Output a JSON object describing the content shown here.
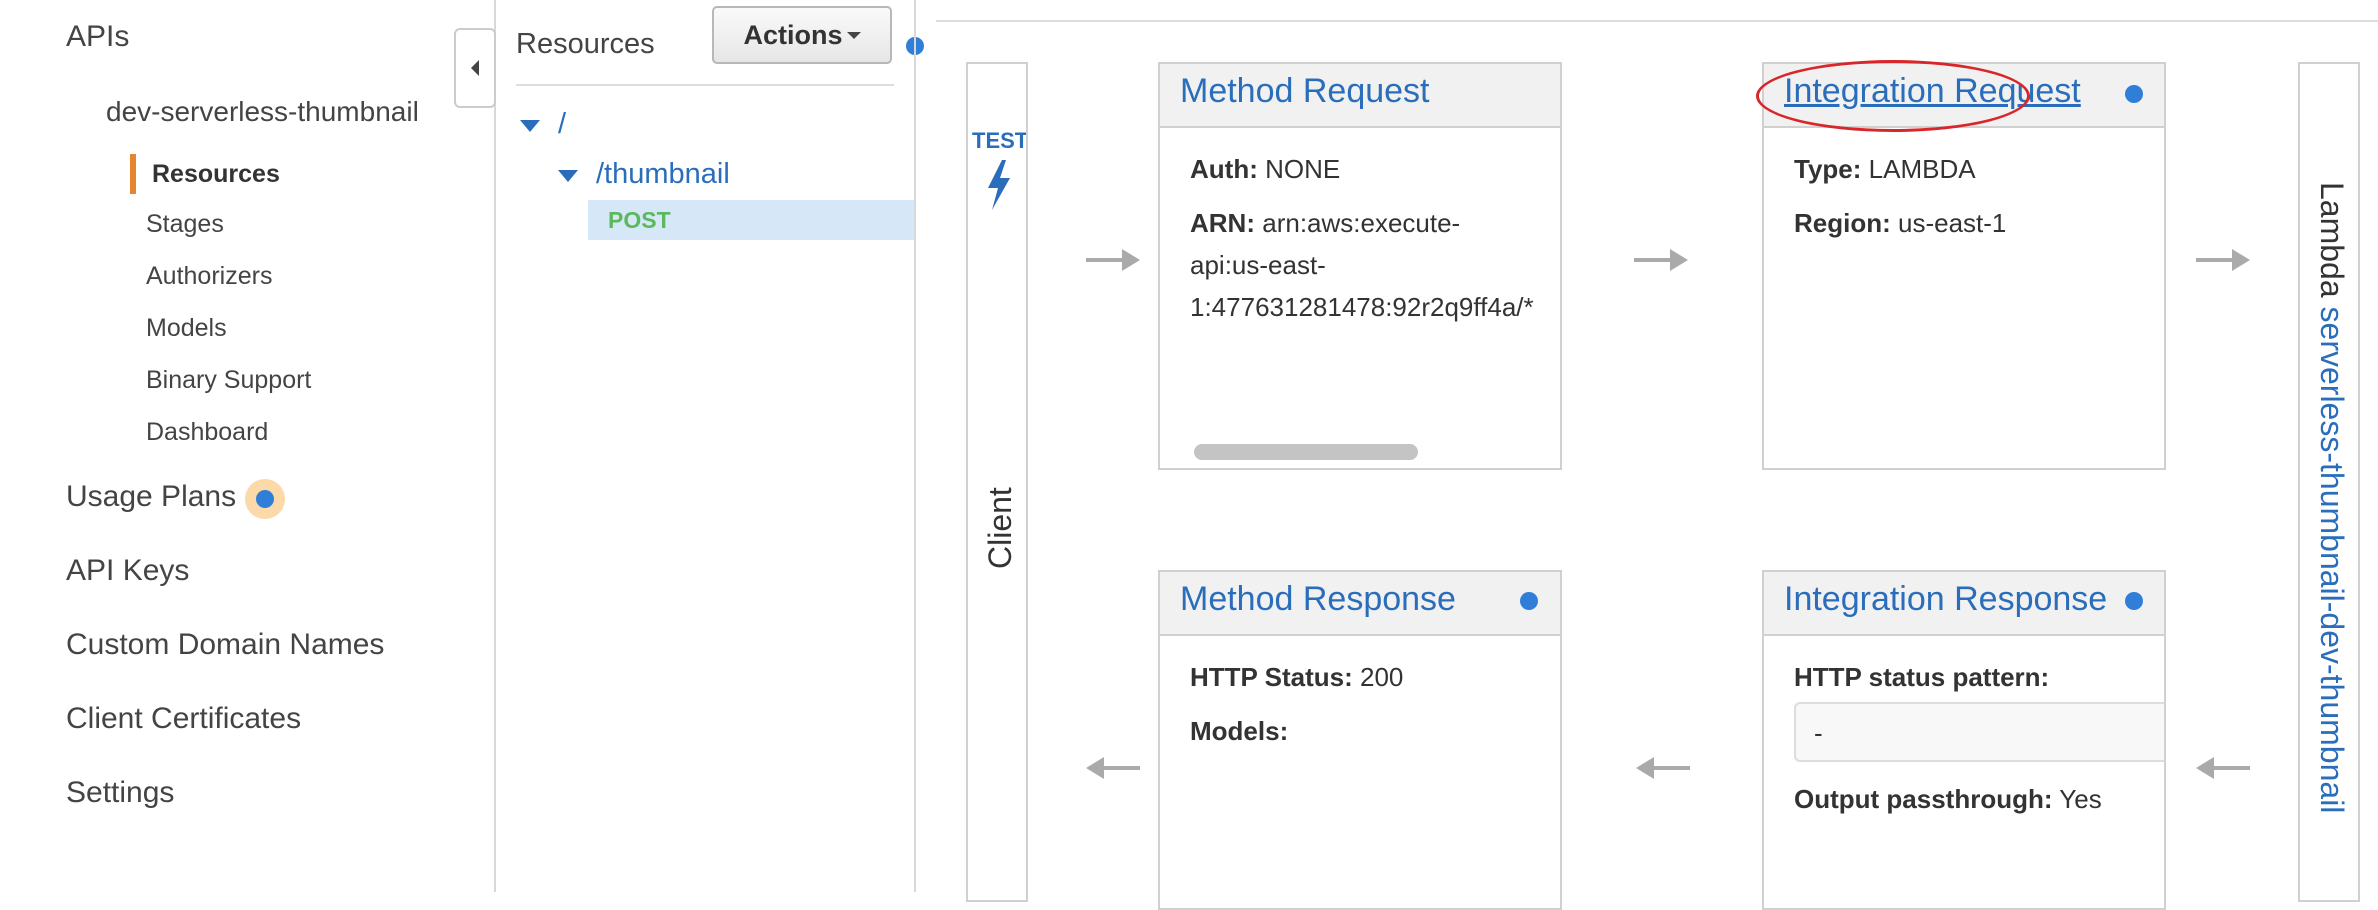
{
  "nav": {
    "apis": "APIs",
    "api_name": "dev-serverless-thumbnail",
    "sub_items": [
      "Resources",
      "Stages",
      "Authorizers",
      "Models",
      "Binary Support",
      "Dashboard"
    ],
    "items": [
      "Usage Plans",
      "API Keys",
      "Custom Domain Names",
      "Client Certificates",
      "Settings"
    ]
  },
  "resources": {
    "title": "Resources",
    "actions_label": "Actions",
    "root": "/",
    "child": "/thumbnail",
    "method": "POST"
  },
  "flow": {
    "client_label": "Client",
    "test_label": "TEST",
    "method_request": {
      "title": "Method Request",
      "auth_key": "Auth:",
      "auth_val": "NONE",
      "arn_key": "ARN:",
      "arn_line1": "arn:aws:execute-",
      "arn_line2": "api:us-east-",
      "arn_line3": "1:477631281478:92r2q9ff4a/*"
    },
    "integration_request": {
      "title": "Integration Request",
      "type_key": "Type:",
      "type_val": "LAMBDA",
      "region_key": "Region:",
      "region_val": "us-east-1"
    },
    "method_response": {
      "title": "Method Response",
      "status_key": "HTTP Status:",
      "status_val": "200",
      "models_key": "Models:"
    },
    "integration_response": {
      "title": "Integration Response",
      "pattern_key": "HTTP status pattern:",
      "pattern_val": "-",
      "passthrough_key": "Output passthrough:",
      "passthrough_val": "Yes"
    },
    "lambda_label": "Lambda",
    "lambda_name": "serverless-thumbnail-dev-thumbnail"
  },
  "colors": {
    "accent": "#e8832e",
    "link": "#2a6ebb",
    "post": "#5cb85c",
    "highlight_circle": "#d9262a"
  }
}
